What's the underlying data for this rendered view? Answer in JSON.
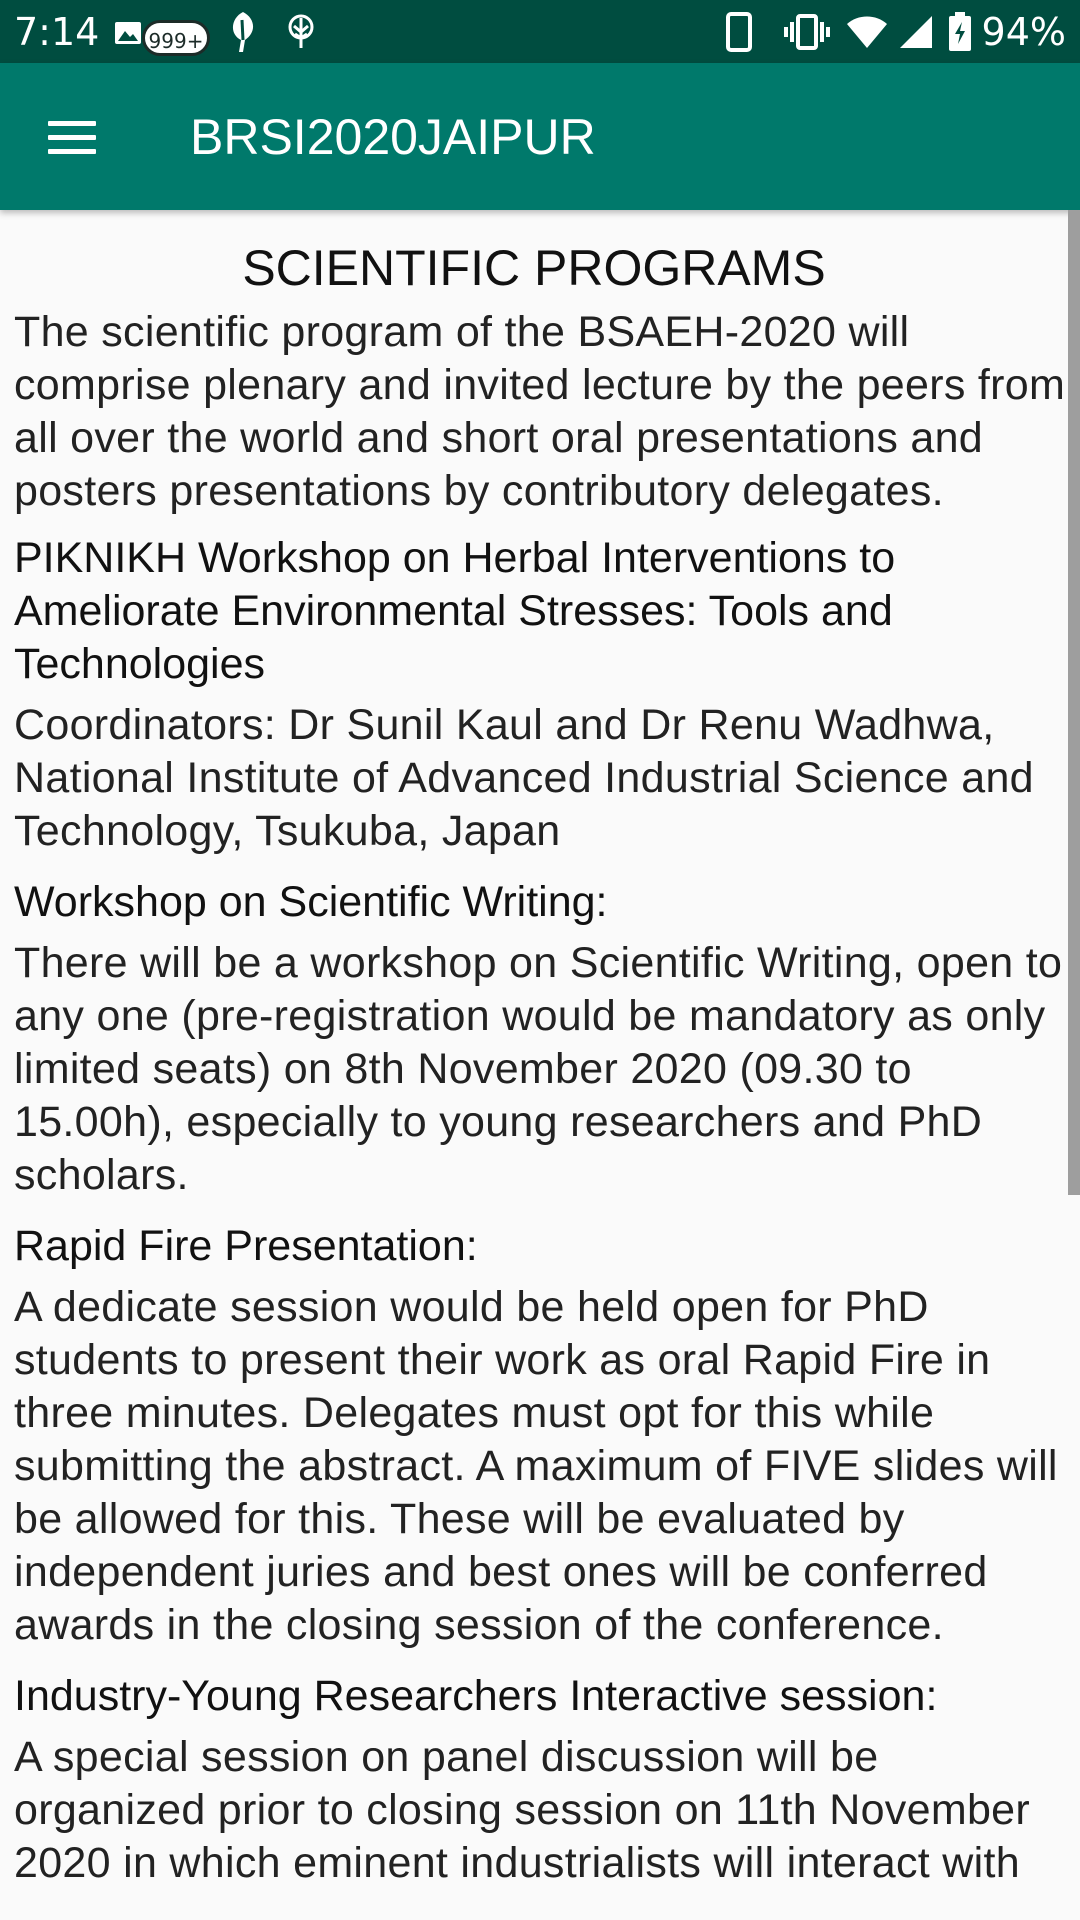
{
  "status_bar": {
    "time": "7:14",
    "notification_badge": "999+",
    "battery_percent": "94%",
    "left_icons": [
      "image-icon",
      "leaf-icon",
      "tree-icon"
    ],
    "right_icons": [
      "phone-icon",
      "vibrate-icon",
      "wifi-icon",
      "signal-icon",
      "battery-icon"
    ]
  },
  "app_bar": {
    "title": "BRSI2020JAIPUR",
    "menu_icon": "hamburger-menu-icon",
    "color": "#00796b"
  },
  "content": {
    "heading": "SCIENTIFIC PROGRAMS",
    "intro": "The scientific program of the BSAEH-2020 will comprise plenary and invited lecture by the peers from all over the world and short oral presentations and posters presentations by contributory delegates.",
    "sections": [
      {
        "title": "PIKNIKH Workshop on Herbal Interventions to Ameliorate Environmental Stresses: Tools and Technologies",
        "body": "Coordinators: Dr Sunil Kaul and Dr Renu Wadhwa, National Institute of Advanced Industrial Science and Technology, Tsukuba, Japan"
      },
      {
        "title": "Workshop on Scientific Writing:",
        "body": "There will be a workshop on Scientific Writing, open to any one (pre-registration would be mandatory as only limited seats) on 8th November 2020 (09.30 to 15.00h), especially to young researchers and PhD scholars."
      },
      {
        "title": "Rapid Fire Presentation:",
        "body": "A dedicate session would be held open for PhD students to present their work as oral Rapid Fire in three minutes. Delegates must opt for this while submitting the abstract. A maximum of FIVE slides will be allowed for this. These will be evaluated by independent juries and best ones will be conferred awards in the closing session of the conference."
      },
      {
        "title": "Industry-Young Researchers Interactive session:",
        "body": "A special session on panel discussion will be organized prior to closing session on 11th November 2020 in which eminent industrialists will interact with"
      }
    ]
  }
}
